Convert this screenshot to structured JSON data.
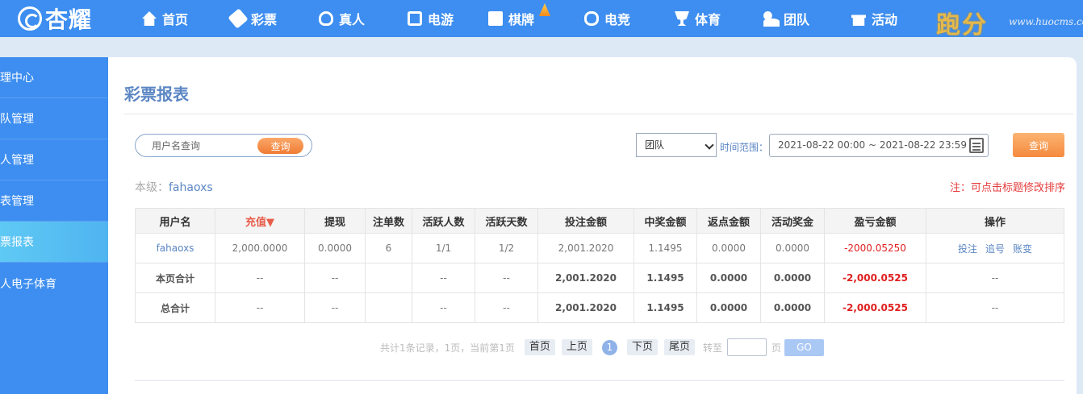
{
  "brand": {
    "logo_text": "杏耀",
    "promo_text": "跑分",
    "watermark": "www.huocms.com"
  },
  "nav": [
    {
      "label": "首页",
      "icon": "home-icon"
    },
    {
      "label": "彩票",
      "icon": "ticket-icon"
    },
    {
      "label": "真人",
      "icon": "person-icon"
    },
    {
      "label": "电游",
      "icon": "slot-machine-icon"
    },
    {
      "label": "棋牌",
      "icon": "card-icon"
    },
    {
      "label": "电竞",
      "icon": "gamepad-icon"
    },
    {
      "label": "体育",
      "icon": "trophy-icon"
    },
    {
      "label": "团队",
      "icon": "team-icon"
    },
    {
      "label": "活动",
      "icon": "gift-icon"
    }
  ],
  "sidebar": {
    "items": [
      {
        "label": "管理中心"
      },
      {
        "label": "团队管理"
      },
      {
        "label": "个人管理"
      },
      {
        "label": "报表管理"
      },
      {
        "label": "彩票报表"
      },
      {
        "label": "真人电子体育"
      }
    ],
    "active_index": 4
  },
  "page": {
    "title": "彩票报表"
  },
  "filters": {
    "username_placeholder": "用户名查询",
    "search_button": "查询",
    "scope_selected": "团队",
    "time_label": "时间范围：",
    "date_range": "2021-08-22 00:00 ~ 2021-08-22 23:59",
    "query_button": "查询"
  },
  "level": {
    "label": "本级：",
    "value": "fahaoxs"
  },
  "note": "注：可点击标题修改排序",
  "table": {
    "headers": [
      "用户名",
      "充值▼",
      "提现",
      "注单数",
      "活跃人数",
      "活跃天数",
      "投注金额",
      "中奖金额",
      "返点金额",
      "活动奖金",
      "盈亏金额",
      "操作"
    ],
    "row": {
      "username": "fahaoxs",
      "recharge": "2,000.0000",
      "withdraw": "0.0000",
      "orders": "6",
      "active_users": "1/1",
      "active_days": "1/2",
      "bet": "2,001.2020",
      "win": "1.1495",
      "rebate": "0.0000",
      "bonus": "0.0000",
      "profit": "-2000.05250",
      "ops": [
        "投注",
        "追号",
        "账变"
      ]
    },
    "page_total": {
      "label": "本页合计",
      "recharge": "--",
      "withdraw": "--",
      "orders": "",
      "active_users": "--",
      "active_days": "--",
      "bet": "2,001.2020",
      "win": "1.1495",
      "rebate": "0.0000",
      "bonus": "0.0000",
      "profit": "-2,000.0525",
      "ops": "--"
    },
    "grand_total": {
      "label": "总合计",
      "recharge": "--",
      "withdraw": "--",
      "orders": "",
      "active_users": "--",
      "active_days": "--",
      "bet": "2,001.2020",
      "win": "1.1495",
      "rebate": "0.0000",
      "bonus": "0.0000",
      "profit": "-2,000.0525",
      "ops": "--"
    }
  },
  "pagination": {
    "info": "共计1条记录，1页，当前第1页",
    "first": "首页",
    "prev": "上页",
    "current": "1",
    "next": "下页",
    "last": "尾页",
    "goto_label": "转至",
    "page_unit": "页",
    "go": "GO"
  },
  "colors": {
    "nav_bg": "#3d8ef0",
    "accent_orange": "#f07c34",
    "link_blue": "#5b86c4",
    "negative_red": "#e02020"
  }
}
